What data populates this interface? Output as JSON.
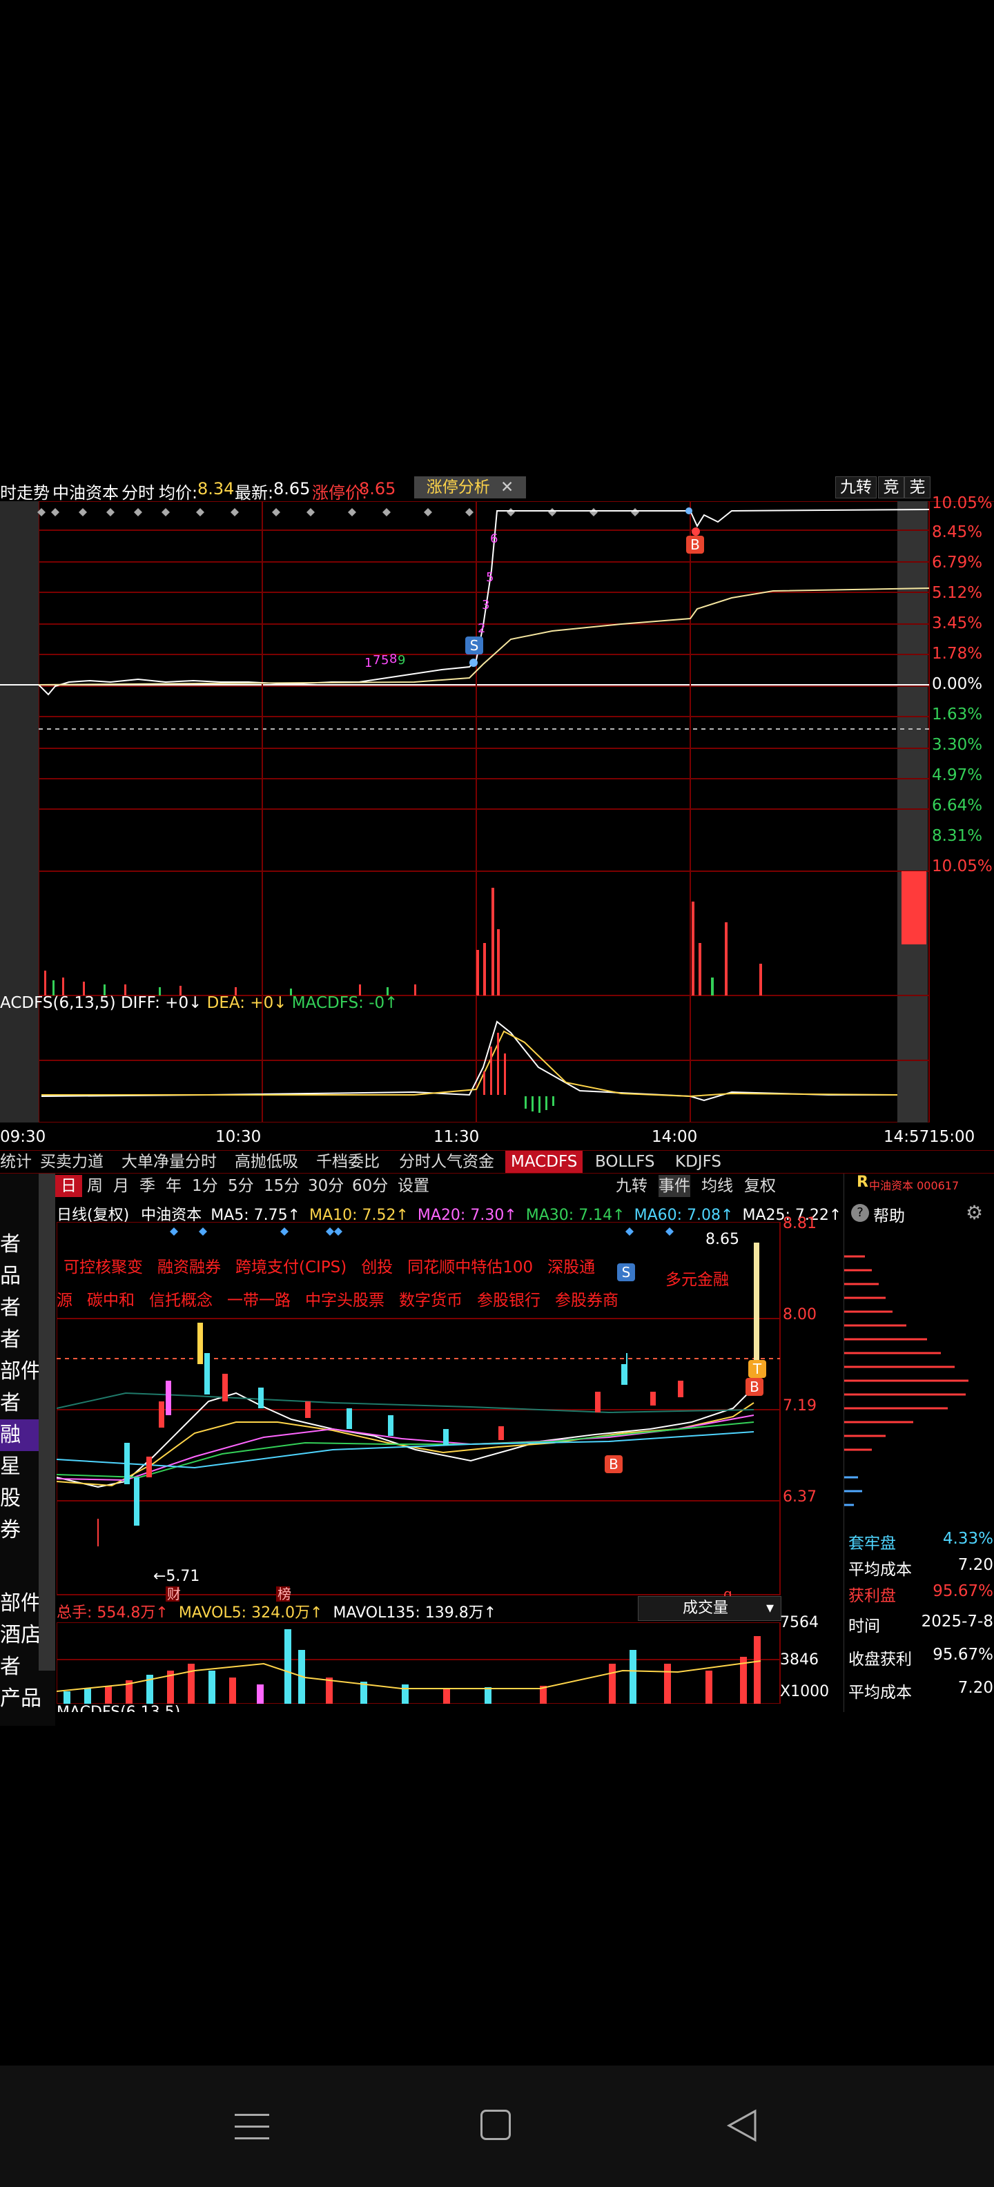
{
  "header": {
    "left_cut": "时走势",
    "stock": "中油资本",
    "mode": "分时",
    "avg_label": "均价:",
    "avg_value": "8.34",
    "latest_label": "最新:",
    "latest_value": "8.65",
    "limit_label": "涨停价:",
    "limit_value": "8.65",
    "tab_limit": "涨停分析",
    "right_btns": [
      "九转",
      "竞",
      "芜"
    ]
  },
  "intraday": {
    "right_labels": [
      "10.05%",
      "8.45%",
      "6.79%",
      "5.12%",
      "3.45%",
      "1.78%",
      "0.00%",
      "1.63%",
      "3.30%",
      "4.97%",
      "6.64%",
      "8.31%",
      "10.05%"
    ],
    "marker_s": "S",
    "marker_b": "B",
    "small_digits": [
      "6",
      "5",
      "3",
      "2",
      "1",
      "7",
      "5",
      "8",
      "9"
    ]
  },
  "macd_line": {
    "label": "ACDFS(6,13,5)",
    "diff_label": "DIFF: +0↓",
    "dea_label": "DEA: +0↓",
    "macdfs_label": "MACDFS: -0↑"
  },
  "time_axis": [
    "09:30",
    "10:30",
    "11:30",
    "14:00",
    "14:57",
    "15:00"
  ],
  "tool_tabs": [
    "统计",
    "买卖力道",
    "大单净量分时",
    "高抛低吸",
    "千档委比",
    "分时人气资金",
    "MACDFS",
    "BOLLFS",
    "KDJFS"
  ],
  "period_tabs": [
    "日",
    "周",
    "月",
    "季",
    "年",
    "1分",
    "5分",
    "15分",
    "30分",
    "60分",
    "设置"
  ],
  "period_right": [
    "九转",
    "事件",
    "均线",
    "复权"
  ],
  "daily": {
    "title": "日线(复权)",
    "stock": "中油资本",
    "ma": [
      {
        "label": "MA5: 7.75↑",
        "color": "#ffffff"
      },
      {
        "label": "MA10: 7.52↑",
        "color": "#ffd54a"
      },
      {
        "label": "MA20: 7.30↑",
        "color": "#ff66ff"
      },
      {
        "label": "MA30: 7.14↑",
        "color": "#34d058"
      },
      {
        "label": "MA60: 7.08↑",
        "color": "#4fd5ff"
      },
      {
        "label": "MA25: 7.22↑",
        "color": "#ffffff"
      },
      {
        "label": "MA",
        "color": "#4fd5ff"
      }
    ],
    "concepts_row1": [
      "可控核聚变",
      "融资融券",
      "跨境支付(CIPS)",
      "创投",
      "同花顺中特估100",
      "深股通"
    ],
    "concepts_row1_right": "多元金融",
    "concepts_row2": [
      "源",
      "碳中和",
      "信托概念",
      "一带一路",
      "中字头股票",
      "数字货币",
      "参股银行",
      "参股券商"
    ],
    "price_labels": [
      "8.81",
      "8.00",
      "7.19",
      "6.37"
    ],
    "high_mark": "8.65",
    "low_mark": "←5.71",
    "tag_cai": "财",
    "tag_bang": "榜",
    "tag_q": "q"
  },
  "volume": {
    "total": "总手: 554.8万↑",
    "mavol5": "MAVOL5: 324.0万↑",
    "mavol135": "MAVOL135: 139.8万↑",
    "selector": "成交量",
    "scale": [
      "7564",
      "3846",
      "X1000"
    ],
    "cut_bottom": "MACDFS(6,13,5)"
  },
  "side_panel": {
    "brand": "中油资本 000617",
    "help": "帮助",
    "stats": [
      {
        "k": "套牢盘",
        "v": "4.33%"
      },
      {
        "k": "平均成本",
        "v": "7.20"
      },
      {
        "k": "获利盘",
        "v": "95.67%"
      }
    ],
    "date_label": "时间",
    "date_value": "2025-7-8",
    "profit_label": "收盘获利",
    "profit_value": "95.67%",
    "cost_label": "平均成本",
    "cost_value": "7.20"
  },
  "left_sidebar": [
    "者",
    "品",
    "者",
    "者",
    "部件",
    "者",
    "融",
    "星",
    "股",
    "券",
    "部件",
    "酒店",
    "者",
    "产品"
  ],
  "colors": {
    "accent": "#c01020",
    "up": "#ff3b3b",
    "down": "#34d058",
    "grid": "#7a0000"
  }
}
